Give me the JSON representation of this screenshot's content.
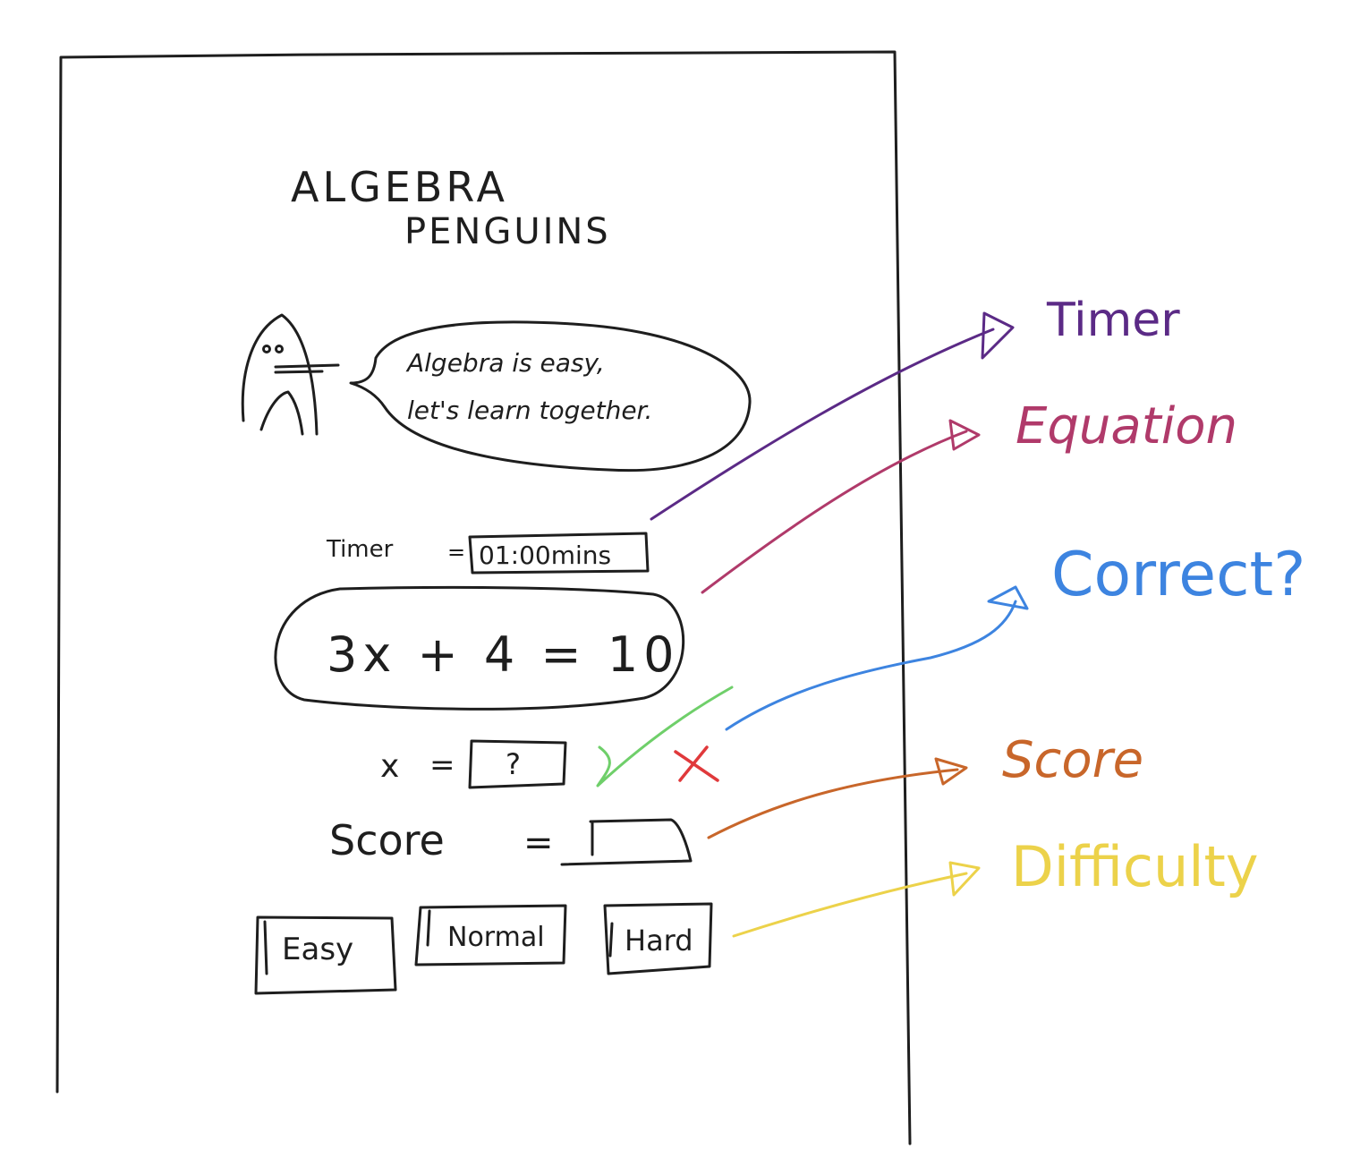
{
  "app": {
    "title_line1": "ALGEBRA",
    "title_line2": "PENGUINS"
  },
  "mascot": {
    "icon": "penguin-icon",
    "speech_line1": "Algebra is easy,",
    "speech_line2": "let's learn together."
  },
  "timer": {
    "label": "Timer",
    "equals": "=",
    "value": "01:00mins"
  },
  "equation": {
    "text": "3x + 4 = 10"
  },
  "answer": {
    "variable": "x",
    "equals": "=",
    "value": "?"
  },
  "feedback": {
    "correct_icon": "checkmark-icon",
    "wrong_icon": "cross-icon"
  },
  "score": {
    "label": "Score",
    "equals": "=",
    "value": ""
  },
  "difficulty": {
    "buttons": [
      "Easy",
      "Normal",
      "Hard"
    ]
  },
  "annotations": {
    "timer": {
      "label": "Timer",
      "color": "#5b2a86"
    },
    "equation": {
      "label": "Equation",
      "color": "#b03a6a"
    },
    "correct": {
      "label": "Correct?",
      "color": "#3d84e0"
    },
    "score": {
      "label": "Score",
      "color": "#c8662a"
    },
    "difficulty": {
      "label": "Difficulty",
      "color": "#ecd24a"
    }
  },
  "colors": {
    "ink": "#1e1e1e",
    "check": "#6fcf6a",
    "cross": "#e0393b"
  }
}
